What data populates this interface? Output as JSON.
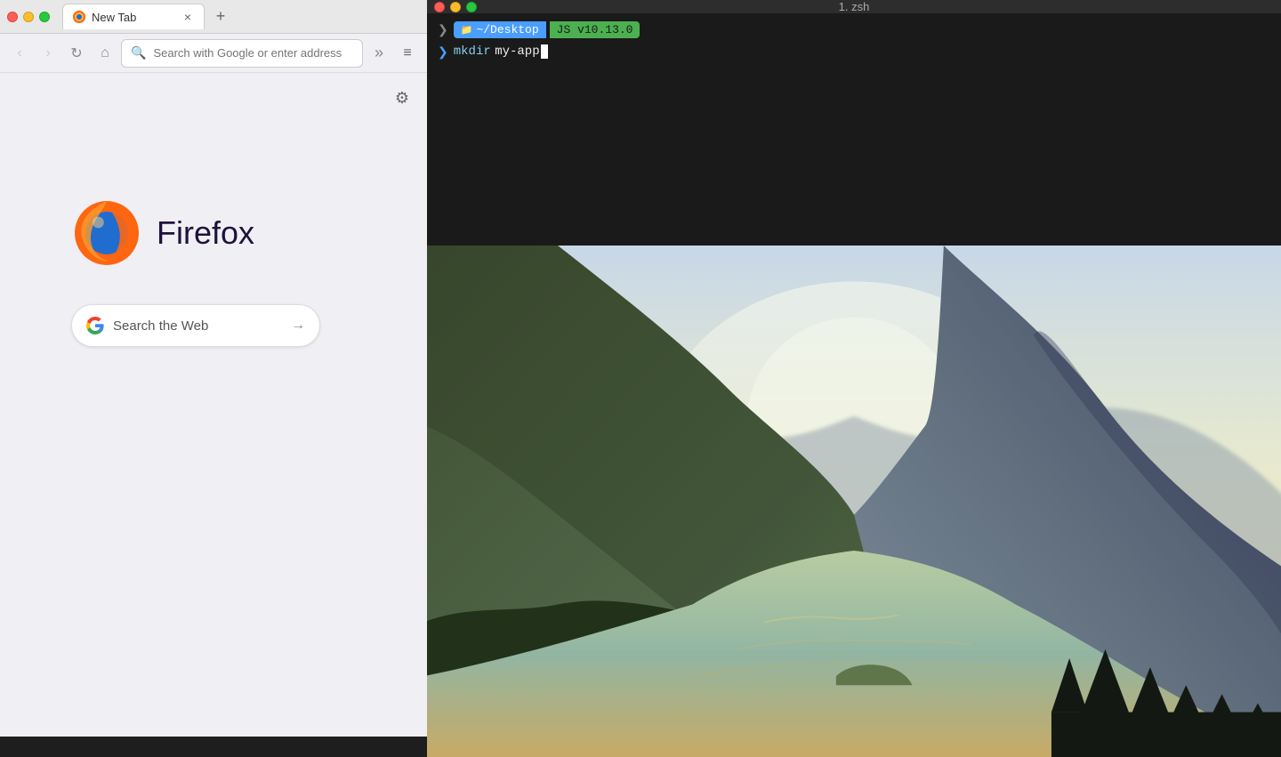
{
  "firefox": {
    "tab": {
      "title": "New Tab",
      "favicon": "firefox-icon"
    },
    "new_tab_label": "+",
    "nav": {
      "back_label": "‹",
      "forward_label": "›",
      "reload_label": "↻",
      "home_label": "⌂",
      "address_placeholder": "Search with Google or enter address",
      "overflow_label": "»",
      "menu_label": "≡"
    },
    "settings_icon": "⚙",
    "branding": {
      "name": "Firefox"
    },
    "search": {
      "label": "Search the Web",
      "arrow": "→"
    }
  },
  "terminal": {
    "title": "1. zsh",
    "prompt": {
      "dir_icon": "📁",
      "dir_label": "~/Desktop",
      "node_label": "JS v10.13.0"
    },
    "command": {
      "keyword": "mkdir",
      "argument": "my-app"
    },
    "traffic_lights": {
      "close_color": "#ff5f57",
      "minimize_color": "#febc2e",
      "maximize_color": "#28c840"
    }
  },
  "colors": {
    "firefox_bg": "#f0f0f4",
    "tab_bg": "#ffffff",
    "terminal_dark": "#1a1a1a",
    "terminal_title_bg": "#2d2d2d",
    "prompt_dir_bg": "#4a9eff",
    "prompt_node_bg": "#4caf50"
  }
}
